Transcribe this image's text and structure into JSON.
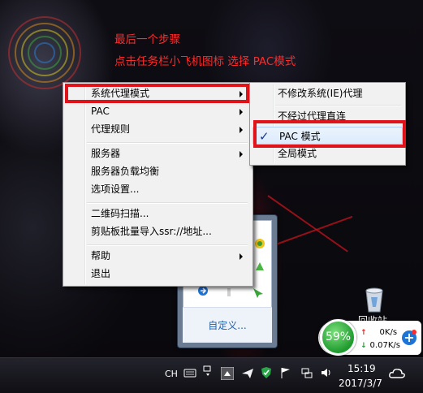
{
  "annotation": {
    "line1": "最后一个步骤",
    "line2": "点击任务栏小飞机图标  选择 PAC模式"
  },
  "context_menu": {
    "items": [
      {
        "label": "系统代理模式",
        "has_submenu": true
      },
      {
        "label": "PAC",
        "has_submenu": true
      },
      {
        "label": "代理规则",
        "has_submenu": true
      },
      {
        "label": "服务器",
        "has_submenu": true
      },
      {
        "label": "服务器负载均衡",
        "has_submenu": false
      },
      {
        "label": "选项设置...",
        "has_submenu": false
      },
      {
        "label": "二维码扫描...",
        "has_submenu": false
      },
      {
        "label": "剪贴板批量导入ssr://地址...",
        "has_submenu": false
      },
      {
        "label": "帮助",
        "has_submenu": true
      },
      {
        "label": "退出",
        "has_submenu": false
      }
    ]
  },
  "proxy_submenu": {
    "items": [
      {
        "label": "不修改系统(IE)代理",
        "checked": false
      },
      {
        "label": "不经过代理直连",
        "checked": false
      },
      {
        "label": "PAC 模式",
        "checked": true
      },
      {
        "label": "全局模式",
        "checked": false
      }
    ],
    "check_glyph": "✓"
  },
  "tray_popup": {
    "customize_link": "自定义..."
  },
  "desktop": {
    "recycle_bin_label": "回收站"
  },
  "net_widget": {
    "percent": "59%",
    "upload": "0K/s",
    "download": "0.07K/s",
    "plus": "+"
  },
  "taskbar": {
    "lang": "CH",
    "time": "15:19",
    "date": "2017/3/7"
  },
  "colors": {
    "highlight": "#e0131b",
    "annotation": "#ff2a2a"
  }
}
